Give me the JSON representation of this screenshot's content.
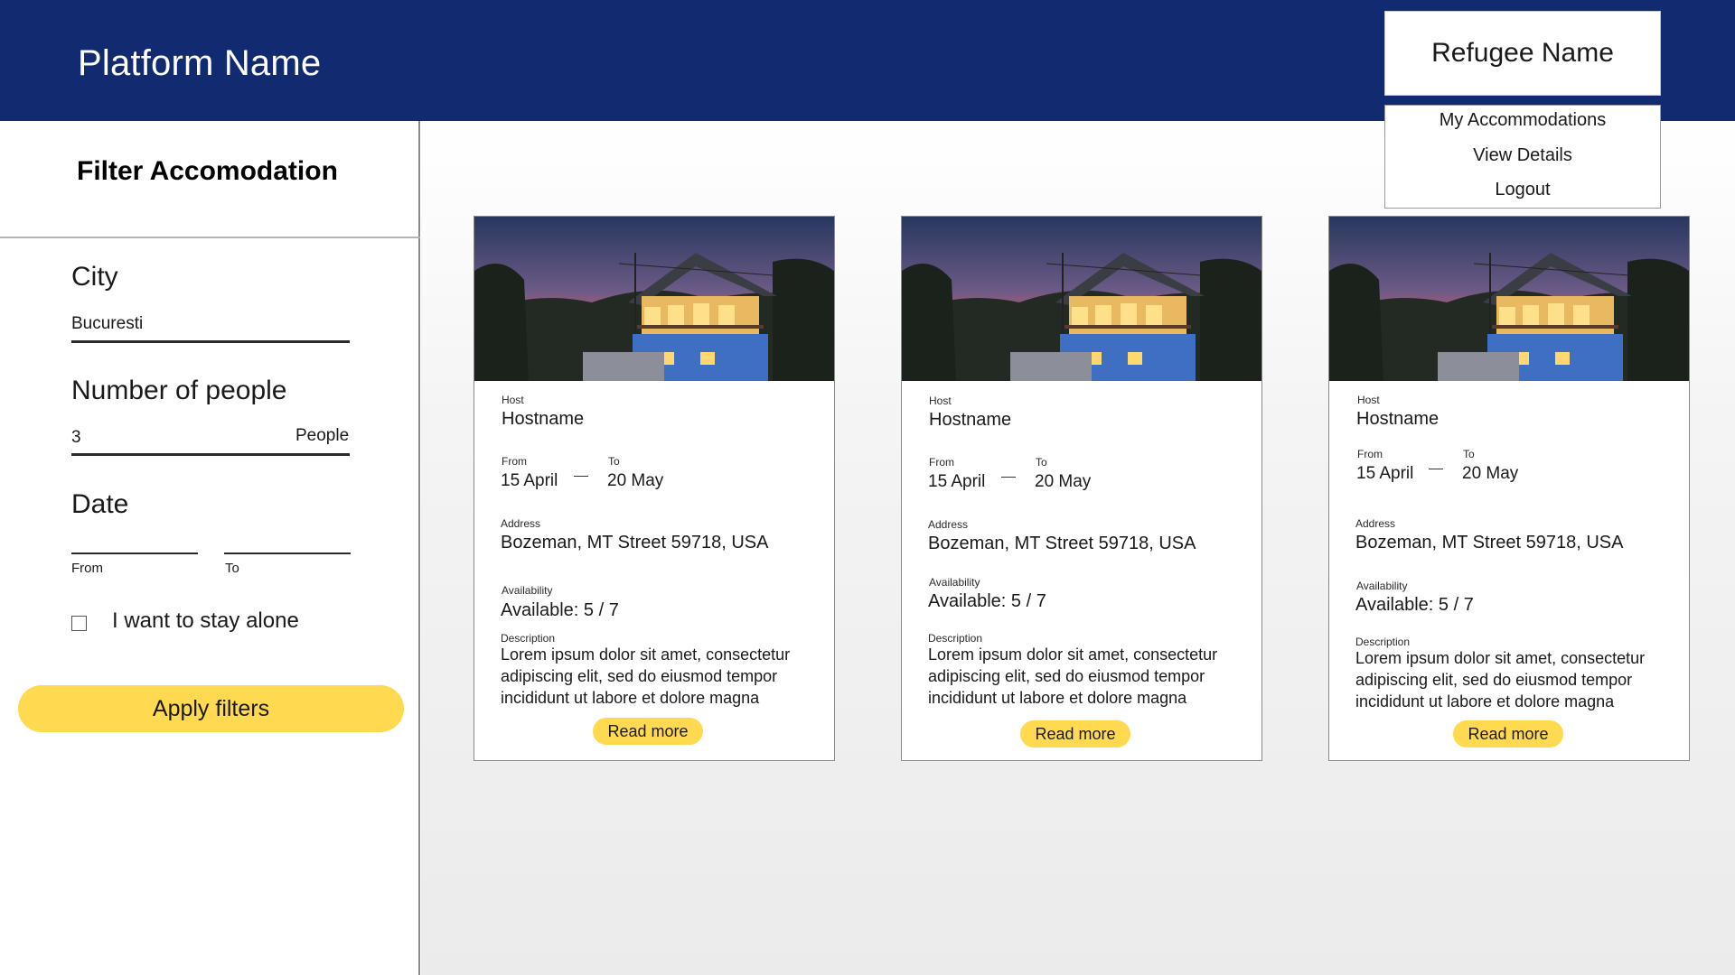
{
  "header": {
    "brand": "Platform Name",
    "user_name": "Refugee Name",
    "menu_items": [
      "My Accommodations",
      "View Details",
      "Logout"
    ]
  },
  "filters": {
    "title": "Filter Accomodation",
    "city_label": "City",
    "city_value": "Bucuresti",
    "people_label": "Number of people",
    "people_value": "3",
    "people_unit": "People",
    "date_label": "Date",
    "from_label": "From",
    "to_label": "To",
    "alone_label": "I want to stay alone",
    "alone_checked": false,
    "apply_label": "Apply filters"
  },
  "cards": [
    {
      "host_label": "Host",
      "host": "Hostname",
      "from_label": "From",
      "from": "15 April",
      "to_label": "To",
      "to": "20 May",
      "address_label": "Address",
      "address": "Bozeman, MT Street 59718, USA",
      "availability_label": "Availability",
      "availability": "Available:  5 / 7",
      "description_label": "Description",
      "description": "Lorem ipsum dolor sit amet, consectetur adipiscing elit, sed do eiusmod tempor incididunt ut labore et dolore magna",
      "read_more": "Read more"
    },
    {
      "host_label": "Host",
      "host": "Hostname",
      "from_label": "From",
      "from": "15 April",
      "to_label": "To",
      "to": "20 May",
      "address_label": "Address",
      "address": "Bozeman, MT Street 59718, USA",
      "availability_label": "Availability",
      "availability": "Available:  5 / 7",
      "description_label": "Description",
      "description": "Lorem ipsum dolor sit amet, consectetur adipiscing elit, sed do eiusmod tempor incididunt ut labore et dolore magna",
      "read_more": "Read more"
    },
    {
      "host_label": "Host",
      "host": "Hostname",
      "from_label": "From",
      "from": "15 April",
      "to_label": "To",
      "to": "20 May",
      "address_label": "Address",
      "address": "Bozeman, MT Street 59718, USA",
      "availability_label": "Availability",
      "availability": "Available:  5 / 7",
      "description_label": "Description",
      "description": "Lorem ipsum dolor sit amet, consectetur adipiscing elit, sed do eiusmod tempor incididunt ut labore et dolore magna",
      "read_more": "Read more"
    }
  ],
  "colors": {
    "header": "#122a6f",
    "accent": "#ffd94f"
  }
}
